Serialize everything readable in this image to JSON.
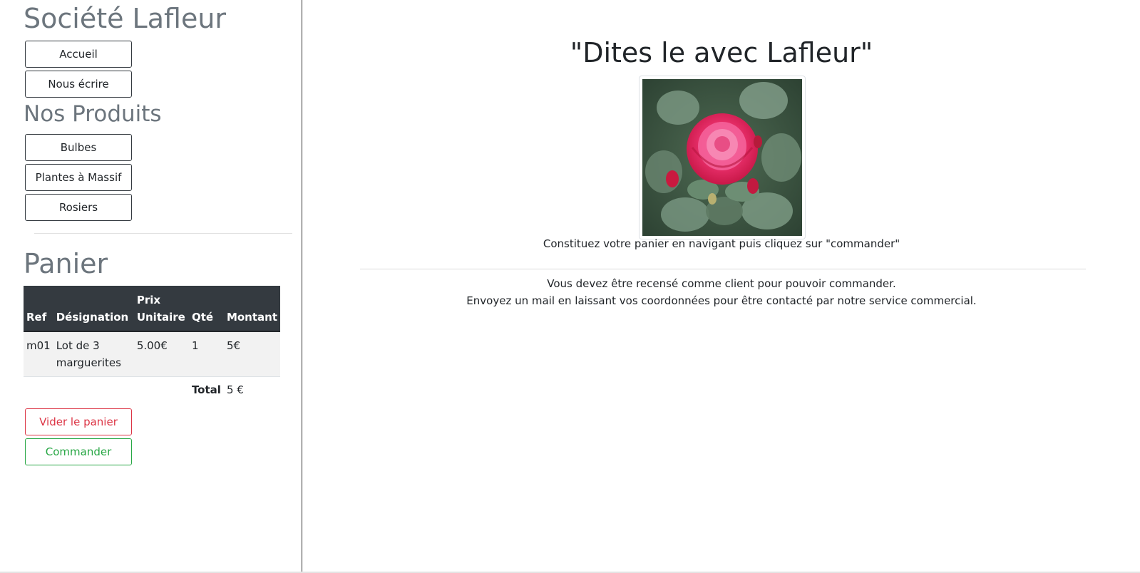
{
  "sidebar": {
    "company_title": "Société Lafleur",
    "nav_buttons": [
      "Accueil",
      "Nous écrire"
    ],
    "products_title": "Nos Produits",
    "product_buttons": [
      "Bulbes",
      "Plantes à Massif",
      "Rosiers"
    ],
    "cart": {
      "title": "Panier",
      "headers": {
        "ref": "Ref",
        "designation": "Désignation",
        "unit_price": "Prix Unitaire",
        "qty": "Qté",
        "amount": "Montant"
      },
      "rows": [
        {
          "ref": "m01",
          "designation": "Lot de 3 marguerites",
          "unit_price": "5.00€",
          "qty": "1",
          "amount": "5€"
        }
      ],
      "total_label": "Total",
      "total_value": "5 €",
      "empty_button": "Vider le panier",
      "order_button": "Commander"
    }
  },
  "main": {
    "title": "\"Dites le avec Lafleur\"",
    "instructions": "Constituez votre panier en navigant puis cliquez sur \"commander\"",
    "notice_line1": "Vous devez être recensé comme client pour pouvoir commander.",
    "notice_line2": "Envoyez un mail en laissant vos coordonnées pour être contacté par notre service commercial."
  },
  "colors": {
    "heading_gray": "#6c757d",
    "table_header": "#343a40",
    "danger": "#dc3545",
    "success": "#28a745"
  }
}
